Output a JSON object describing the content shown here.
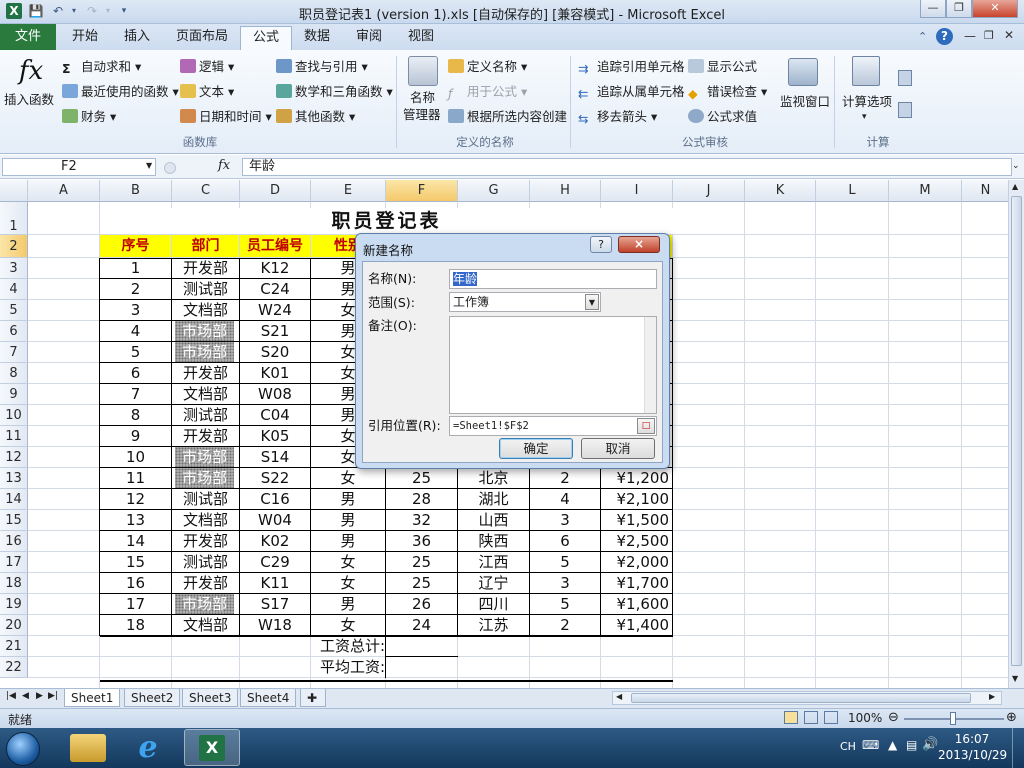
{
  "window": {
    "title": "职员登记表1 (version 1).xls [自动保存的]  [兼容模式] - Microsoft Excel"
  },
  "ribbon": {
    "tabs": [
      "文件",
      "开始",
      "插入",
      "页面布局",
      "公式",
      "数据",
      "审阅",
      "视图"
    ],
    "active_tab": "公式",
    "insert_function": "插入函数",
    "function_library": {
      "autosum": "自动求和",
      "recent": "最近使用的函数",
      "financial": "财务",
      "logical": "逻辑",
      "text": "文本",
      "datetime": "日期和时间",
      "lookup": "查找与引用",
      "math": "数学和三角函数",
      "other": "其他函数",
      "group_label": "函数库"
    },
    "defined_names": {
      "name_manager_line1": "名称",
      "name_manager_line2": "管理器",
      "define_name": "定义名称",
      "use_in_formula": "用于公式",
      "create_from_selection": "根据所选内容创建",
      "group_label": "定义的名称"
    },
    "formula_auditing": {
      "trace_precedents": "追踪引用单元格",
      "trace_dependents": "追踪从属单元格",
      "remove_arrows": "移去箭头",
      "show_formulas": "显示公式",
      "error_checking": "错误检查",
      "evaluate_formula": "公式求值",
      "watch_window": "监视窗口",
      "group_label": "公式审核"
    },
    "calculation": {
      "options": "计算选项",
      "group_label": "计算"
    }
  },
  "formula_bar": {
    "name_box": "F2",
    "fx": "fx",
    "content": "年龄"
  },
  "columns": [
    "A",
    "B",
    "C",
    "D",
    "E",
    "F",
    "G",
    "H",
    "I",
    "J",
    "K",
    "L",
    "M",
    "N"
  ],
  "selected_column": "F",
  "selected_row": 2,
  "sheet": {
    "title": "职员登记表",
    "headers": [
      "序号",
      "部门",
      "员工编号",
      "性别",
      "年龄",
      "籍贯",
      "工龄",
      "工资"
    ],
    "rows": [
      [
        "1",
        "开发部",
        "K12",
        "男",
        "",
        "",
        "",
        ""
      ],
      [
        "2",
        "测试部",
        "C24",
        "男",
        "",
        "",
        "",
        ""
      ],
      [
        "3",
        "文档部",
        "W24",
        "女",
        "",
        "",
        "",
        ""
      ],
      [
        "4",
        "市场部",
        "S21",
        "男",
        "",
        "",
        "",
        ""
      ],
      [
        "5",
        "市场部",
        "S20",
        "女",
        "",
        "",
        "",
        ""
      ],
      [
        "6",
        "开发部",
        "K01",
        "女",
        "",
        "",
        "",
        ""
      ],
      [
        "7",
        "文档部",
        "W08",
        "男",
        "",
        "",
        "",
        ""
      ],
      [
        "8",
        "测试部",
        "C04",
        "男",
        "",
        "",
        "",
        ""
      ],
      [
        "9",
        "开发部",
        "K05",
        "女",
        "",
        "",
        "",
        ""
      ],
      [
        "10",
        "市场部",
        "S14",
        "女",
        "",
        "",
        "",
        ""
      ],
      [
        "11",
        "市场部",
        "S22",
        "女",
        "25",
        "北京",
        "2",
        "¥1,200"
      ],
      [
        "12",
        "测试部",
        "C16",
        "男",
        "28",
        "湖北",
        "4",
        "¥2,100"
      ],
      [
        "13",
        "文档部",
        "W04",
        "男",
        "32",
        "山西",
        "3",
        "¥1,500"
      ],
      [
        "14",
        "开发部",
        "K02",
        "男",
        "36",
        "陕西",
        "6",
        "¥2,500"
      ],
      [
        "15",
        "测试部",
        "C29",
        "女",
        "25",
        "江西",
        "5",
        "¥2,000"
      ],
      [
        "16",
        "开发部",
        "K11",
        "女",
        "25",
        "辽宁",
        "3",
        "¥1,700"
      ],
      [
        "17",
        "市场部",
        "S17",
        "男",
        "26",
        "四川",
        "5",
        "¥1,600"
      ],
      [
        "18",
        "文档部",
        "W18",
        "女",
        "24",
        "江苏",
        "2",
        "¥1,400"
      ]
    ],
    "total_label": "工资总计:",
    "avg_label": "平均工资:"
  },
  "sheet_tabs": [
    "Sheet1",
    "Sheet2",
    "Sheet3",
    "Sheet4"
  ],
  "active_sheet": "Sheet1",
  "status": {
    "mode": "就绪",
    "zoom": "100%"
  },
  "dialog": {
    "title": "新建名称",
    "help": "?",
    "close": "×",
    "name_label": "名称(N):",
    "name_value": "年龄",
    "scope_label": "范围(S):",
    "scope_value": "工作簿",
    "comment_label": "备注(O):",
    "refers_label": "引用位置(R):",
    "refers_value": "=Sheet1!$F$2",
    "ok": "确定",
    "cancel": "取消"
  },
  "taskbar": {
    "lang": "CH",
    "time": "16:07",
    "date": "2013/10/29"
  }
}
